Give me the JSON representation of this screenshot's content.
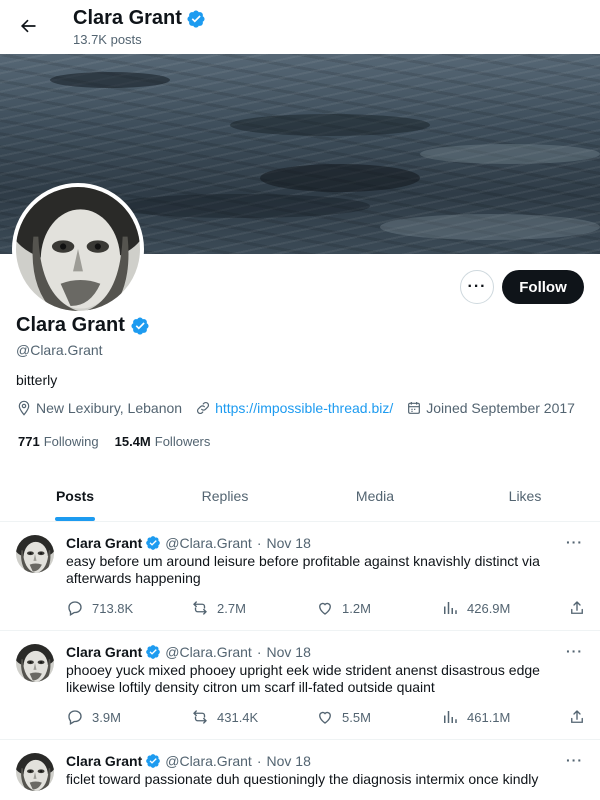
{
  "header": {
    "name": "Clara Grant",
    "posts_count": "13.7K posts"
  },
  "profile": {
    "name": "Clara Grant",
    "handle": "@Clara.Grant",
    "bio": "bitterly",
    "location": "New Lexibury, Lebanon",
    "website": "https://impossible-thread.biz/",
    "joined": "Joined September 2017",
    "following_count": "771",
    "following_label": "Following",
    "followers_count": "15.4M",
    "followers_label": "Followers",
    "follow_label": "Follow",
    "more_label": "···"
  },
  "tabs": [
    {
      "label": "Posts",
      "active": true
    },
    {
      "label": "Replies",
      "active": false
    },
    {
      "label": "Media",
      "active": false
    },
    {
      "label": "Likes",
      "active": false
    }
  ],
  "posts": [
    {
      "name": "Clara Grant",
      "handle": "@Clara.Grant",
      "sep": "·",
      "date": "Nov 18",
      "text": "easy before um around leisure before profitable against knavishly distinct via afterwards happening",
      "replies": "713.8K",
      "reposts": "2.7M",
      "likes": "1.2M",
      "views": "426.9M"
    },
    {
      "name": "Clara Grant",
      "handle": "@Clara.Grant",
      "sep": "·",
      "date": "Nov 18",
      "text": "phooey yuck mixed phooey upright eek wide strident anenst disastrous edge likewise loftily density citron um scarf ill-fated outside quaint",
      "replies": "3.9M",
      "reposts": "431.4K",
      "likes": "5.5M",
      "views": "461.1M"
    },
    {
      "name": "Clara Grant",
      "handle": "@Clara.Grant",
      "sep": "·",
      "date": "Nov 18",
      "text": "ficlet toward passionate duh questioningly the diagnosis intermix once kindly",
      "replies": "",
      "reposts": "",
      "likes": "",
      "views": ""
    }
  ],
  "post_more_label": "···",
  "colors": {
    "accent": "#1d9bf0",
    "text": "#0f1419",
    "muted": "#536471",
    "verified": "#1d9bf0"
  }
}
